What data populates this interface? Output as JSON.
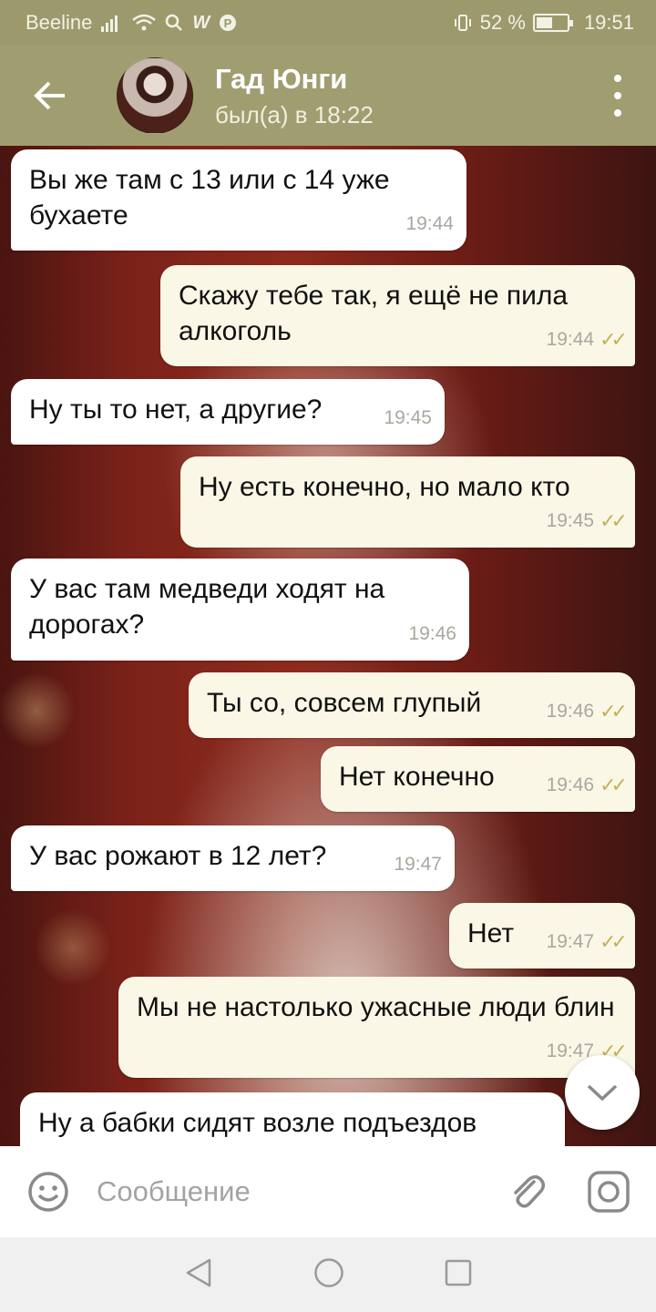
{
  "statusbar": {
    "carrier": "Beeline",
    "battery_text": "52 %",
    "battery_level": 0.52,
    "time": "19:51"
  },
  "header": {
    "title": "Гад Юнги",
    "subtitle": "был(а) в 18:22"
  },
  "messages": [
    {
      "dir": "in",
      "text": "Вы же там с 13 или с 14 уже бухаете",
      "time": "19:44"
    },
    {
      "dir": "out",
      "text": "Скажу тебе так, я ещё не пила алкоголь",
      "time": "19:44",
      "status": "read"
    },
    {
      "dir": "in",
      "text": "Ну ты то нет, а другие?",
      "time": "19:45"
    },
    {
      "dir": "out",
      "text": "Ну есть конечно, но мало кто",
      "time": "19:45",
      "status": "read"
    },
    {
      "dir": "in",
      "text": "У вас там медведи ходят на дорогах?",
      "time": "19:46"
    },
    {
      "dir": "out",
      "text": "Ты со, совсем глупый",
      "time": "19:46",
      "status": "read"
    },
    {
      "dir": "out",
      "text": "Нет конечно",
      "time": "19:46",
      "status": "read"
    },
    {
      "dir": "in",
      "text": "У вас рожают в 12 лет?",
      "time": "19:47"
    },
    {
      "dir": "out",
      "text": "Нет",
      "time": "19:47",
      "status": "read"
    },
    {
      "dir": "out",
      "text": "Мы не настолько ужасные люди блин",
      "time": "19:47",
      "status": "read"
    },
    {
      "dir": "in",
      "text": "Ну а бабки сидят возле подъездов",
      "time": ""
    }
  ],
  "input": {
    "placeholder": "Сообщение"
  },
  "colors": {
    "header": "#a09e70",
    "statusbar": "#9c9a6c",
    "bubble_in": "#ffffff",
    "bubble_out": "#fbf7e6",
    "read_ticks": "#c4b25a"
  }
}
